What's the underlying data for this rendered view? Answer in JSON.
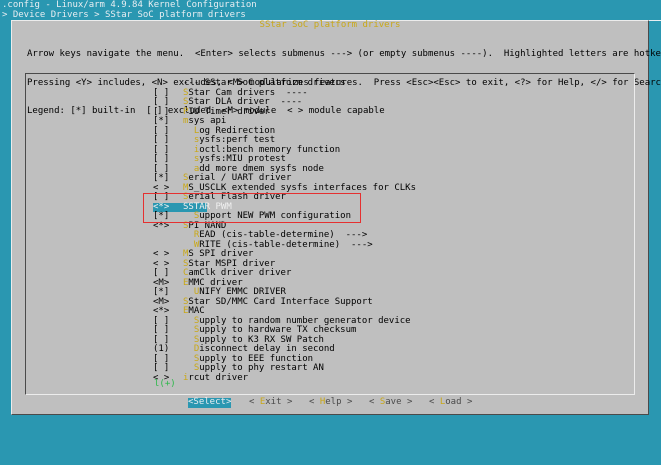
{
  "window": {
    "title": ".config - Linux/arm 4.9.84 Kernel Configuration",
    "breadcrumb": "> Device Drivers > SStar SoC platform drivers"
  },
  "dialog": {
    "title": "SStar SoC platform drivers",
    "help": [
      "Arrow keys navigate the menu.  <Enter> selects submenus ---> (or empty submenus ----).  Highlighted letters are hotkeys.",
      "Pressing <Y> includes, <N> excludes, <M> modularizes features.  Press <Esc><Esc> to exit, <?> for Help, </> for Search.",
      "Legend: [*] built-in  [ ] excluded  <M> module  < > module capable"
    ]
  },
  "menu": {
    "items": [
      {
        "mark": "",
        "first": "",
        "rest": "--- SStar SoC platform drivers"
      },
      {
        "mark": "[ ]",
        "first": "S",
        "rest": "Star Cam drivers  ----"
      },
      {
        "mark": "[ ]",
        "first": "S",
        "rest": "Star DLA driver  ----"
      },
      {
        "mark": "[ ]",
        "first": "P",
        "rest": "IU Timer driver"
      },
      {
        "mark": "[*]",
        "first": "m",
        "rest": "sys api"
      },
      {
        "mark": "[ ]",
        "first": "",
        "rest": "  ",
        "first2": "L",
        "rest2": "og Redirection"
      },
      {
        "mark": "[ ]",
        "first": "",
        "rest": "  ",
        "first2": "s",
        "rest2": "ysfs:perf test"
      },
      {
        "mark": "[ ]",
        "first": "",
        "rest": "  ",
        "first2": "i",
        "rest2": "octl:bench memory function"
      },
      {
        "mark": "[ ]",
        "first": "",
        "rest": "  ",
        "first2": "s",
        "rest2": "ysfs:MIU protest"
      },
      {
        "mark": "[ ]",
        "first": "",
        "rest": "  ",
        "first2": "a",
        "rest2": "dd more dmem sysfs node"
      },
      {
        "mark": "[*]",
        "first": "S",
        "rest": "erial / UART driver"
      },
      {
        "mark": "< >",
        "first": "M",
        "rest": "S_USCLK extended sysfs interfaces for CLKs"
      },
      {
        "mark": "[ ]",
        "first": "S",
        "rest": "erial Flash driver"
      },
      {
        "mark": "<*>",
        "first": "S",
        "rest": "STAR PWM",
        "selected": true
      },
      {
        "mark": "[*]",
        "first": "",
        "rest": "  ",
        "first2": "S",
        "rest2": "upport NEW PWM configuration"
      },
      {
        "mark": "<*>",
        "first": "S",
        "rest": "PI NAND"
      },
      {
        "mark": "",
        "first": "",
        "rest": "  ",
        "first2": "R",
        "rest2": "EAD (cis-table-determine)  --->"
      },
      {
        "mark": "",
        "first": "",
        "rest": "  ",
        "first2": "W",
        "rest2": "RITE (cis-table-determine)  --->"
      },
      {
        "mark": "< >",
        "first": "M",
        "rest": "S SPI driver"
      },
      {
        "mark": "< >",
        "first": "S",
        "rest": "Star MSPI driver"
      },
      {
        "mark": "[ ]",
        "first": "C",
        "rest": "amClk driver driver"
      },
      {
        "mark": "<M>",
        "first": "E",
        "rest": "MMC driver"
      },
      {
        "mark": "[*]",
        "first": "",
        "rest": "  ",
        "first2": "U",
        "rest2": "NIFY EMMC DRIVER"
      },
      {
        "mark": "<M>",
        "first": "S",
        "rest": "Star SD/MMC Card Interface Support"
      },
      {
        "mark": "<*>",
        "first": "E",
        "rest": "MAC"
      },
      {
        "mark": "[ ]",
        "first": "",
        "rest": "  ",
        "first2": "S",
        "rest2": "upply to random number generator device"
      },
      {
        "mark": "[ ]",
        "first": "",
        "rest": "  ",
        "first2": "S",
        "rest2": "upply to hardware TX checksum"
      },
      {
        "mark": "[ ]",
        "first": "",
        "rest": "  ",
        "first2": "S",
        "rest2": "upply to K3 RX SW Patch"
      },
      {
        "mark": "(1)",
        "first": "",
        "rest": "  ",
        "first2": "D",
        "rest2": "isconnect delay in second"
      },
      {
        "mark": "[ ]",
        "first": "",
        "rest": "  ",
        "first2": "S",
        "rest2": "upply to EEE function"
      },
      {
        "mark": "[ ]",
        "first": "",
        "rest": "  ",
        "first2": "S",
        "rest2": "upply to phy restart AN"
      },
      {
        "mark": "< >",
        "first": "i",
        "rest": "rcut driver"
      }
    ],
    "more_indicator": "l(+)"
  },
  "buttons": {
    "select": {
      "lb": "<",
      "hk": "S",
      "rest": "elect",
      "rb": ">"
    },
    "exit": {
      "lb": "< ",
      "hk": "E",
      "rest": "xit",
      "rb": " >"
    },
    "help": {
      "lb": "< ",
      "hk": "H",
      "rest": "elp",
      "rb": " >"
    },
    "save": {
      "lb": "< ",
      "hk": "S",
      "rest": "ave",
      "rb": " >"
    },
    "load": {
      "lb": "< ",
      "hk": "L",
      "rest": "oad",
      "rb": " >"
    }
  }
}
